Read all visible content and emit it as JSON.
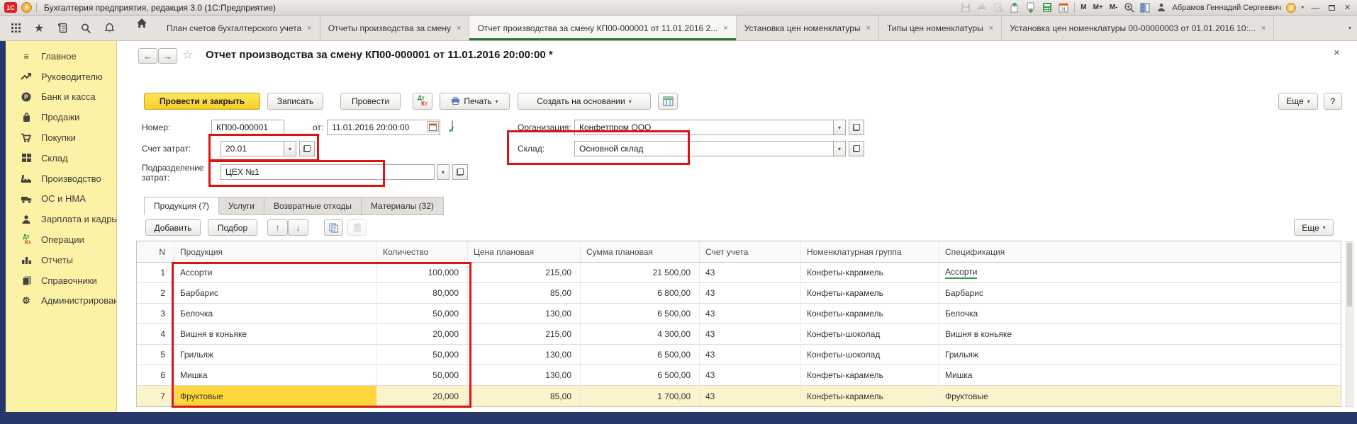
{
  "titlebar": {
    "logo": "1С",
    "app_title": "Бухгалтерия предприятия, редакция 3.0 (1С:Предприятие)",
    "memory_buttons": [
      "М",
      "М+",
      "М-"
    ],
    "user_name": "Абрамов Геннадий Сергеевич"
  },
  "tabbar": {
    "tabs": [
      {
        "label": "План счетов бухгалтерского учета"
      },
      {
        "label": "Отчеты производства за смену"
      },
      {
        "label": "Отчет производства за смену КП00-000001 от 11.01.2016 2..."
      },
      {
        "label": "Установка цен номенклатуры"
      },
      {
        "label": "Типы цен номенклатуры"
      },
      {
        "label": "Установка цен номенклатуры 00-00000003 от 01.01.2016 10:..."
      }
    ]
  },
  "sidebar": {
    "items": [
      {
        "label": "Главное",
        "icon": "menu-icon"
      },
      {
        "label": "Руководителю",
        "icon": "trend-icon"
      },
      {
        "label": "Банк и касса",
        "icon": "ruble-circle-icon"
      },
      {
        "label": "Продажи",
        "icon": "shopping-bag-icon"
      },
      {
        "label": "Покупки",
        "icon": "shopping-cart-icon"
      },
      {
        "label": "Склад",
        "icon": "warehouse-icon"
      },
      {
        "label": "Производство",
        "icon": "factory-icon"
      },
      {
        "label": "ОС и НМА",
        "icon": "truck-icon"
      },
      {
        "label": "Зарплата и кадры",
        "icon": "person-icon"
      },
      {
        "label": "Операции",
        "icon": "dtkt-icon"
      },
      {
        "label": "Отчеты",
        "icon": "bar-chart-icon"
      },
      {
        "label": "Справочники",
        "icon": "books-icon"
      },
      {
        "label": "Администрирование",
        "icon": "gear-icon"
      }
    ]
  },
  "doc": {
    "title": "Отчет производства за смену КП00-000001 от 11.01.2016 20:00:00 *",
    "toolbar": {
      "post_close": "Провести и закрыть",
      "save": "Записать",
      "post": "Провести",
      "print": "Печать",
      "create_based": "Создать на основании",
      "more": "Еще",
      "help": "?"
    },
    "fields": {
      "number_label": "Номер:",
      "number": "КП00-000001",
      "date_label": "от:",
      "date": "11.01.2016 20:00:00",
      "org_label": "Организация:",
      "org": "Конфетпром ООО",
      "cost_account_label": "Счет затрат:",
      "cost_account": "20.01",
      "warehouse_label": "Склад:",
      "warehouse": "Основной склад",
      "department_label": "Подразделение затрат:",
      "department": "ЦЕХ №1"
    },
    "tabs": [
      "Продукция (7)",
      "Услуги",
      "Возвратные отходы",
      "Материалы (32)"
    ],
    "table_toolbar": {
      "add": "Добавить",
      "pick": "Подбор",
      "more": "Еще"
    },
    "table": {
      "columns": [
        "N",
        "Продукция",
        "Количество",
        "Цена плановая",
        "Сумма плановая",
        "Счет учета",
        "Номенклатурная группа",
        "Спецификация"
      ],
      "rows": [
        [
          "1",
          "Ассорти",
          "100,000",
          "215,00",
          "21 500,00",
          "43",
          "Конфеты-карамель",
          "Ассорти"
        ],
        [
          "2",
          "Барбарис",
          "80,000",
          "85,00",
          "6 800,00",
          "43",
          "Конфеты-карамель",
          "Барбарис"
        ],
        [
          "3",
          "Белочка",
          "50,000",
          "130,00",
          "6 500,00",
          "43",
          "Конфеты-карамель",
          "Белочка"
        ],
        [
          "4",
          "Вишня в коньяке",
          "20,000",
          "215,00",
          "4 300,00",
          "43",
          "Конфеты-шоколад",
          "Вишня в коньяке"
        ],
        [
          "5",
          "Грильяж",
          "50,000",
          "130,00",
          "6 500,00",
          "43",
          "Конфеты-шоколад",
          "Грильяж"
        ],
        [
          "6",
          "Мишка",
          "50,000",
          "130,00",
          "6 500,00",
          "43",
          "Конфеты-карамель",
          "Мишка"
        ],
        [
          "7",
          "Фруктовые",
          "20,000",
          "85,00",
          "1 700,00",
          "43",
          "Конфеты-карамель",
          "Фруктовые"
        ]
      ]
    }
  },
  "icons": {
    "caret_down": "▾",
    "close": "×",
    "back": "←",
    "forward": "→",
    "star_outline": "☆",
    "star": "★",
    "menu": "≡",
    "gear": "⚙",
    "dt": "Дт",
    "kt": "Кт",
    "minimize": "—",
    "up": "↑",
    "down": "↓",
    "home": "⌂",
    "info": "i",
    "zoom": "⊕"
  },
  "colors": {
    "annotation_red": "#dd1411",
    "accent_yellow": "#f6cd28",
    "sidebar_yellow": "#fcf2a5",
    "active_green": "#1e7a33",
    "statusbar_navy": "#26386a"
  }
}
